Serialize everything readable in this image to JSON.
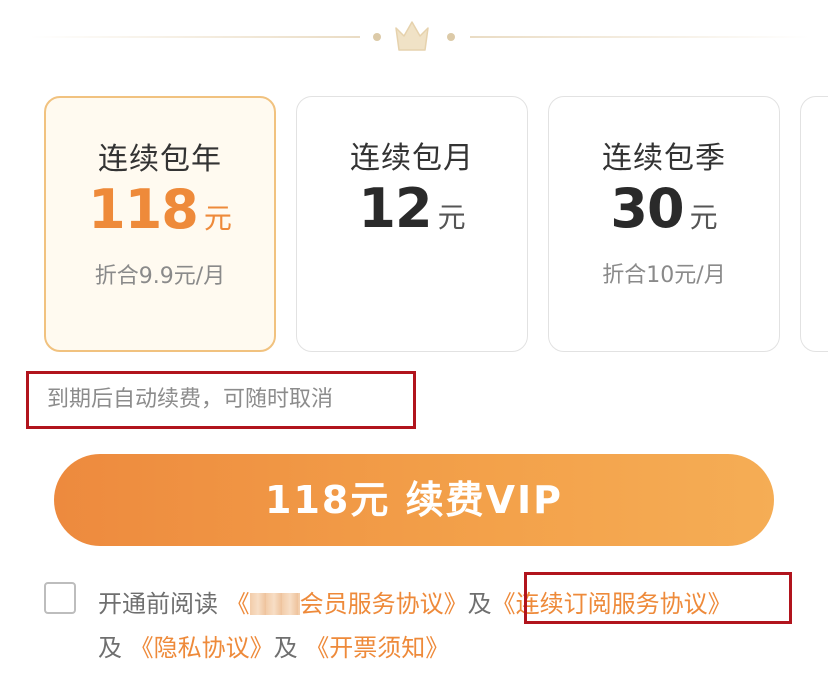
{
  "plans": [
    {
      "name": "连续包年",
      "price": "118",
      "unit": "元",
      "subtitle": "折合9.9元/月",
      "selected": true
    },
    {
      "name": "连续包月",
      "price": "12",
      "unit": "元",
      "subtitle": "",
      "selected": false
    },
    {
      "name": "连续包季",
      "price": "30",
      "unit": "元",
      "subtitle": "折合10元/月",
      "selected": false
    }
  ],
  "renew_note": "到期后自动续费，可随时取消",
  "renew_button": "118元 续费VIP",
  "agreement": {
    "prefix": "开通前阅读",
    "member_agreement": "《",
    "member_agreement_suffix": "会员服务协议》",
    "and1": "及",
    "subscription_agreement": "《连续订阅服务协议》",
    "and2": "及",
    "privacy_agreement": "《隐私协议》",
    "and3": "及",
    "invoice_notice": "《开票须知》"
  },
  "colors": {
    "accent": "#ee8a3a",
    "selected_border": "#f1c27f",
    "highlight_border": "#b1141d"
  },
  "icons": {
    "crown": "crown-icon"
  }
}
